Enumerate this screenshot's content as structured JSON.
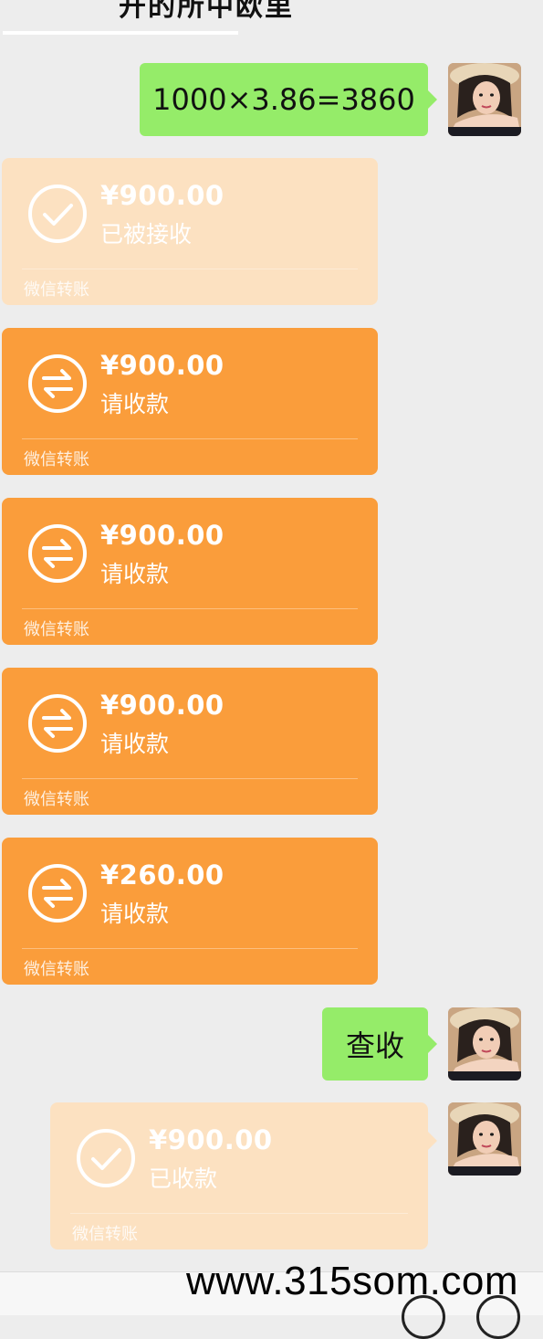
{
  "header": {
    "title": "开的所中欧里"
  },
  "messages": {
    "calc": {
      "text": "1000×3.86=3860"
    },
    "check": {
      "text": "查收"
    }
  },
  "transfers": [
    {
      "amount": "¥900.00",
      "status": "已被接收",
      "label": "微信转账",
      "state": "received"
    },
    {
      "amount": "¥900.00",
      "status": "请收款",
      "label": "微信转账",
      "state": "pending"
    },
    {
      "amount": "¥900.00",
      "status": "请收款",
      "label": "微信转账",
      "state": "pending"
    },
    {
      "amount": "¥900.00",
      "status": "请收款",
      "label": "微信转账",
      "state": "pending"
    },
    {
      "amount": "¥260.00",
      "status": "请收款",
      "label": "微信转账",
      "state": "pending"
    },
    {
      "amount": "¥900.00",
      "status": "已收款",
      "label": "微信转账",
      "state": "received"
    }
  ],
  "watermark": "www.315som.com",
  "colors": {
    "chat_bg": "#ededed",
    "my_bubble": "#95ec69",
    "transfer_pending": "#fa9d3b",
    "transfer_done": "#fce1c1"
  }
}
